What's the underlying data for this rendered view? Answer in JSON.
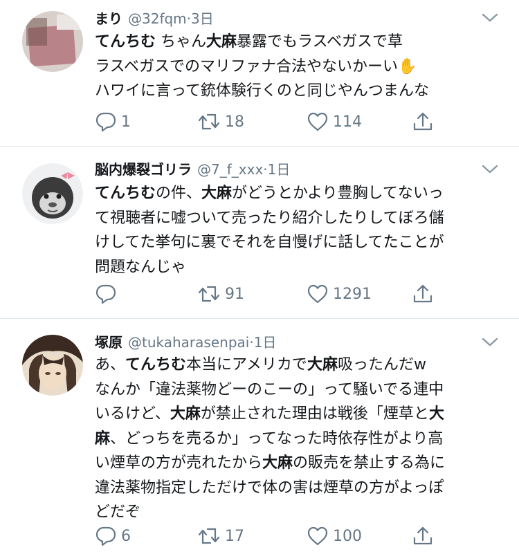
{
  "tweets": [
    {
      "name": "まり",
      "handle": "@32fqm",
      "sep": "·",
      "time": "3日",
      "lines": [
        [
          {
            "t": "てんちむ",
            "b": true
          },
          {
            "t": " ちゃん"
          },
          {
            "t": "大麻",
            "b": true
          },
          {
            "t": "暴露でもラスベガスで草"
          }
        ],
        [
          {
            "t": "ラスベガスでのマリファナ合法やないかーい✋"
          }
        ],
        [
          {
            "t": "ハワイに言って銃体験行くのと同じやんつまんな"
          }
        ]
      ],
      "reply_count": "1",
      "retweet_count": "18",
      "like_count": "114"
    },
    {
      "name": "脳内爆裂ゴリラ",
      "handle": "@7_f_xxx",
      "sep": "·",
      "time": "1日",
      "lines": [
        [
          {
            "t": "てんちむ",
            "b": true
          },
          {
            "t": "の件、"
          },
          {
            "t": "大麻",
            "b": true
          },
          {
            "t": "がどうとかより豊胸してないっ"
          }
        ],
        [
          {
            "t": "て視聴者に嘘ついて売ったり紹介したりしてぼろ儲"
          }
        ],
        [
          {
            "t": "けしてた挙句に裏でそれを自慢げに話してたことが"
          }
        ],
        [
          {
            "t": "問題なんじゃ"
          }
        ]
      ],
      "reply_count": "",
      "retweet_count": "91",
      "like_count": "1291"
    },
    {
      "name": "塚原",
      "handle": "@tukaharasenpai",
      "sep": "·",
      "time": "1日",
      "lines": [
        [
          {
            "t": "あ、"
          },
          {
            "t": "てんちむ",
            "b": true
          },
          {
            "t": "本当にアメリカで"
          },
          {
            "t": "大麻",
            "b": true
          },
          {
            "t": "吸ったんだw"
          }
        ],
        [
          {
            "t": "なんか「違法薬物どーのこーの」って騒いでる連中"
          }
        ],
        [
          {
            "t": "いるけど、"
          },
          {
            "t": "大麻",
            "b": true
          },
          {
            "t": "が禁止された理由は戦後「煙草と"
          },
          {
            "t": "大",
            "b": true
          }
        ],
        [
          {
            "t": "麻",
            "b": true
          },
          {
            "t": "、どっちを売るか」ってなった時依存性がより高"
          }
        ],
        [
          {
            "t": "い煙草の方が売れたから"
          },
          {
            "t": "大麻",
            "b": true
          },
          {
            "t": "の販売を禁止する為に"
          }
        ],
        [
          {
            "t": "違法薬物指定しただけで体の害は煙草の方がよっぽ"
          }
        ],
        [
          {
            "t": "どだぞ"
          }
        ]
      ],
      "reply_count": "6",
      "retweet_count": "17",
      "like_count": "100"
    }
  ],
  "icons": {
    "reply": "reply-icon",
    "retweet": "retweet-icon",
    "like": "heart-icon",
    "share": "share-icon",
    "caret": "chevron-down-icon"
  },
  "colors": {
    "text": "#14171a",
    "secondary": "#657786",
    "divider": "#e1e8ed"
  }
}
